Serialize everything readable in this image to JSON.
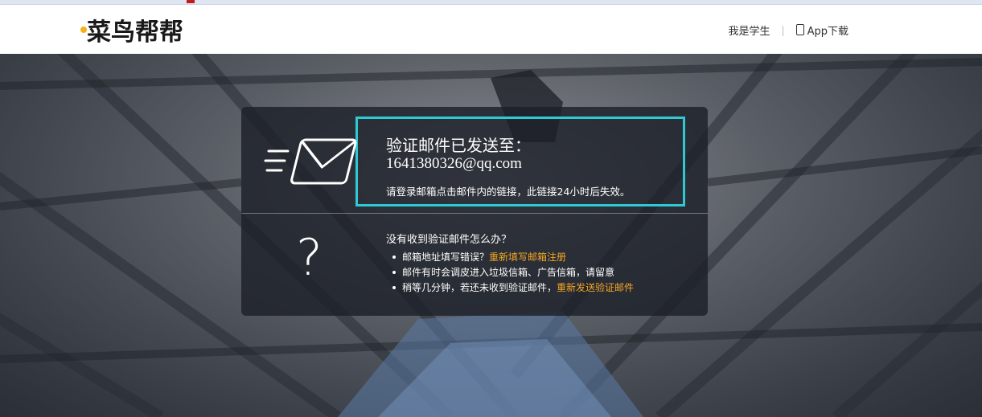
{
  "header": {
    "logo_text": "菜鸟帮帮",
    "nav": {
      "student_label": "我是学生",
      "separator": "|",
      "app_download_label": "App下载"
    }
  },
  "verify": {
    "title": "验证邮件已发送至：",
    "email": "1641380326@qq.com",
    "note": "请登录邮箱点击邮件内的链接，此链接24小时后失效。"
  },
  "help": {
    "question_mark": "?",
    "title": "没有收到验证邮件怎么办？",
    "items": [
      {
        "text": "邮箱地址填写错误？",
        "link": "重新填写邮箱注册"
      },
      {
        "text": "邮件有时会调皮进入垃圾信箱、广告信箱，请留意",
        "link": ""
      },
      {
        "text": "稍等几分钟，若还未收到验证邮件，",
        "link": "重新发送验证邮件"
      }
    ]
  },
  "colors": {
    "accent_link": "#f5a623",
    "highlight_border": "#2ec9d3",
    "logo_yellow": "#f3b21b"
  },
  "icons": [
    "envelope-icon",
    "question-icon",
    "phone-icon"
  ]
}
